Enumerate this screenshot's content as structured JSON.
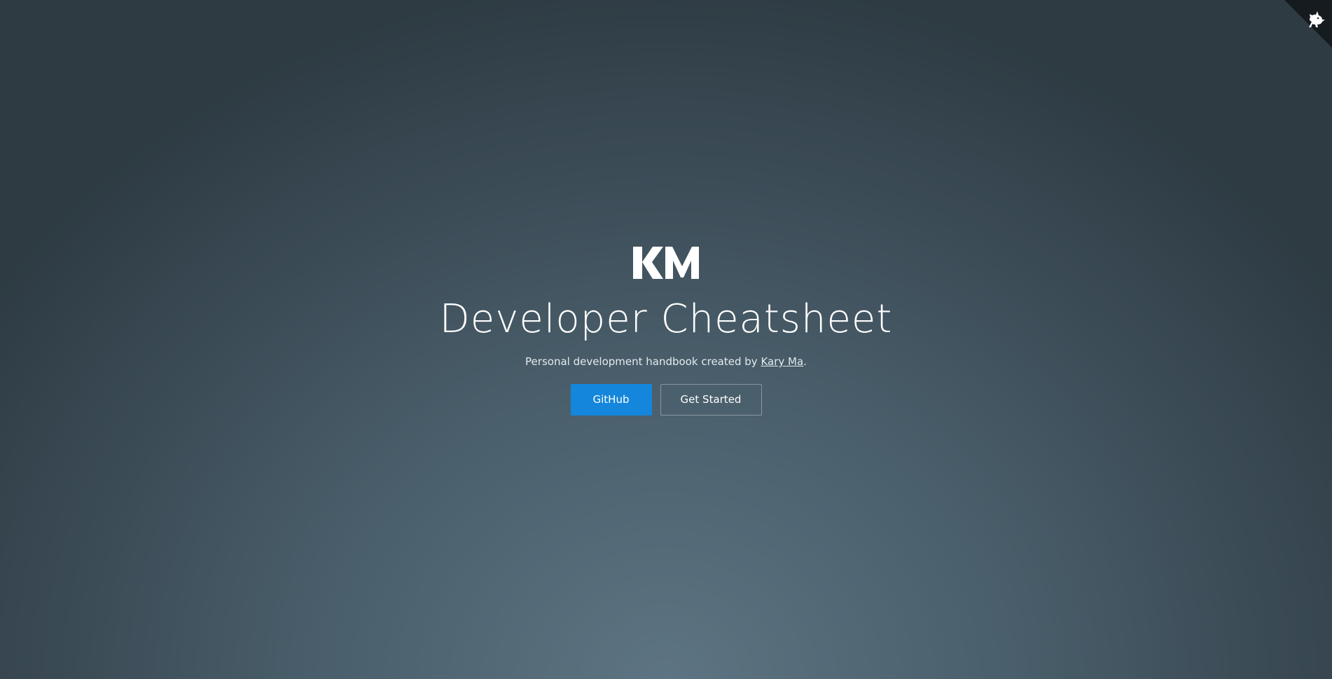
{
  "corner_link": {
    "icon": "cat-icon"
  },
  "cover": {
    "logo_text": "KM",
    "title": "Developer Cheatsheet",
    "subtitle_prefix": "Personal development handbook created by ",
    "author_link": "Kary Ma",
    "subtitle_suffix": "."
  },
  "buttons": {
    "github_label": "GitHub",
    "get_started_label": "Get Started"
  },
  "colors": {
    "primary_button": "#1486db",
    "background_center": "#5d7482",
    "background_edge": "#2e3b43",
    "corner_badge": "#161b1f"
  }
}
